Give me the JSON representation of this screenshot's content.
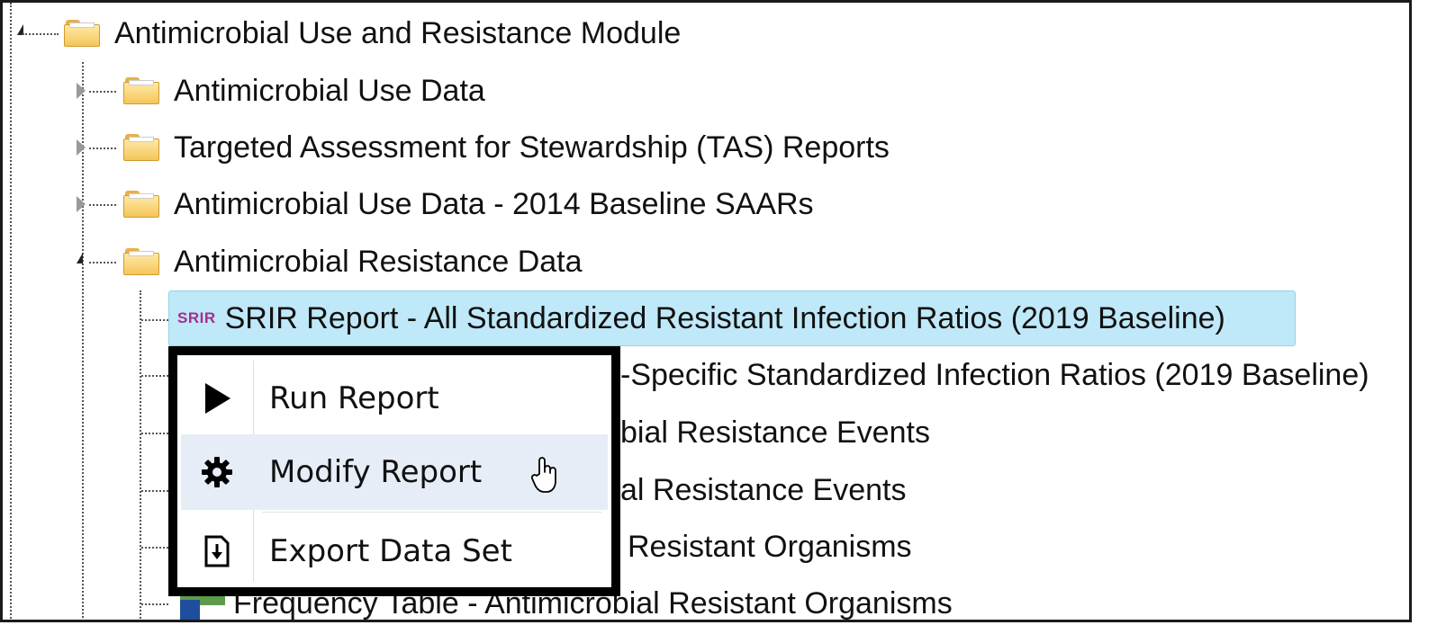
{
  "tree": {
    "root": {
      "label": "Antimicrobial Use and Resistance Module"
    },
    "folders": [
      {
        "label": "Antimicrobial Use Data",
        "expanded": false
      },
      {
        "label": "Targeted Assessment for Stewardship (TAS) Reports",
        "expanded": false
      },
      {
        "label": "Antimicrobial Use Data - 2014 Baseline SAARs",
        "expanded": false
      },
      {
        "label": "Antimicrobial Resistance Data",
        "expanded": true
      }
    ],
    "reports": [
      {
        "badge": "SRIR",
        "label": "SRIR Report - All Standardized Resistant Infection Ratios (2019 Baseline)"
      },
      {
        "label": "-Specific Standardized Infection Ratios (2019 Baseline)"
      },
      {
        "label": "bial Resistance Events"
      },
      {
        "label": "al Resistance Events"
      },
      {
        "label": "Resistant Organisms"
      },
      {
        "label": "Frequency Table - Antimicrobial Resistant Organisms"
      }
    ]
  },
  "context_menu": {
    "items": [
      {
        "label": "Run Report",
        "icon": "play-icon"
      },
      {
        "label": "Modify Report",
        "icon": "gear-icon"
      },
      {
        "label": "Export Data Set",
        "icon": "export-icon"
      }
    ]
  },
  "colors": {
    "selection": "#bfe8f8",
    "badge": "#a2308f",
    "menu_hover": "#e6edf7"
  }
}
